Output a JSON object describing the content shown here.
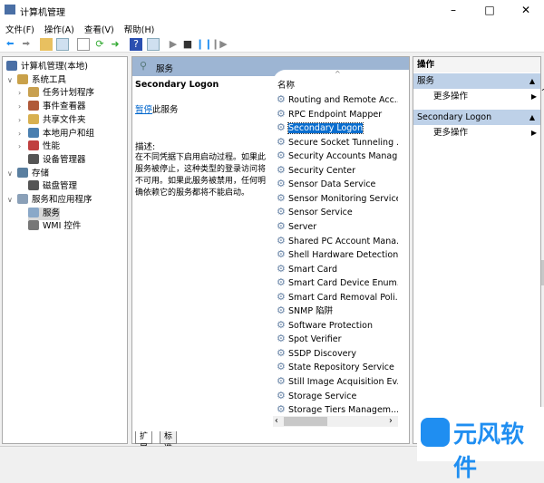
{
  "window": {
    "title": "计算机管理"
  },
  "menu": [
    "文件(F)",
    "操作(A)",
    "查看(V)",
    "帮助(H)"
  ],
  "tree": [
    {
      "label": "计算机管理(本地)",
      "level": 0,
      "color": "#4a6fa5"
    },
    {
      "label": "系统工具",
      "level": 1,
      "expanded": true,
      "color": "#c9a14a"
    },
    {
      "label": "任务计划程序",
      "level": 2,
      "collapsed": true,
      "color": "#c8a050"
    },
    {
      "label": "事件查看器",
      "level": 2,
      "collapsed": true,
      "color": "#b05a3a"
    },
    {
      "label": "共享文件夹",
      "level": 2,
      "collapsed": true,
      "color": "#d8b050"
    },
    {
      "label": "本地用户和组",
      "level": 2,
      "collapsed": true,
      "color": "#4a7fb0"
    },
    {
      "label": "性能",
      "level": 2,
      "collapsed": true,
      "color": "#c04040"
    },
    {
      "label": "设备管理器",
      "level": 2,
      "color": "#555"
    },
    {
      "label": "存储",
      "level": 1,
      "expanded": true,
      "color": "#5a7fa0"
    },
    {
      "label": "磁盘管理",
      "level": 2,
      "color": "#555"
    },
    {
      "label": "服务和应用程序",
      "level": 1,
      "expanded": true,
      "color": "#8aa0b8"
    },
    {
      "label": "服务",
      "level": 2,
      "selected": true,
      "color": "#8aa8c8"
    },
    {
      "label": "WMI 控件",
      "level": 2,
      "color": "#777"
    }
  ],
  "middle": {
    "header": "服务",
    "service_name": "Secondary Logon",
    "pause_link": "暂停",
    "pause_suffix": "此服务",
    "desc_label": "描述:",
    "description": "在不同凭据下启用启动过程。如果此服务被停止，这种类型的登录访问将不可用。如果此服务被禁用，任何明确依赖它的服务都将不能启动。",
    "column_name": "名称",
    "services": [
      "Routing and Remote Acc...",
      "RPC Endpoint Mapper",
      "Secondary Logon",
      "Secure Socket Tunneling ...",
      "Security Accounts Manag...",
      "Security Center",
      "Sensor Data Service",
      "Sensor Monitoring Service",
      "Sensor Service",
      "Server",
      "Shared PC Account Mana...",
      "Shell Hardware Detection",
      "Smart Card",
      "Smart Card Device Enum...",
      "Smart Card Removal Poli...",
      "SNMP 陷阱",
      "Software Protection",
      "Spot Verifier",
      "SSDP Discovery",
      "State Repository Service",
      "Still Image Acquisition Ev...",
      "Storage Service",
      "Storage Tiers Managem..."
    ],
    "selected_service": "Secondary Logon",
    "tabs": [
      "扩展",
      "标准"
    ]
  },
  "actions": {
    "title": "操作",
    "sections": [
      {
        "header": "服务",
        "item": "更多操作"
      },
      {
        "header": "Secondary Logon",
        "item": "更多操作"
      }
    ]
  },
  "watermark": "元风软件",
  "colors": {
    "selection": "#0a6ecf",
    "header": "#9db5d3",
    "action_header": "#bed1e8",
    "watermark": "#1f8ef1"
  }
}
